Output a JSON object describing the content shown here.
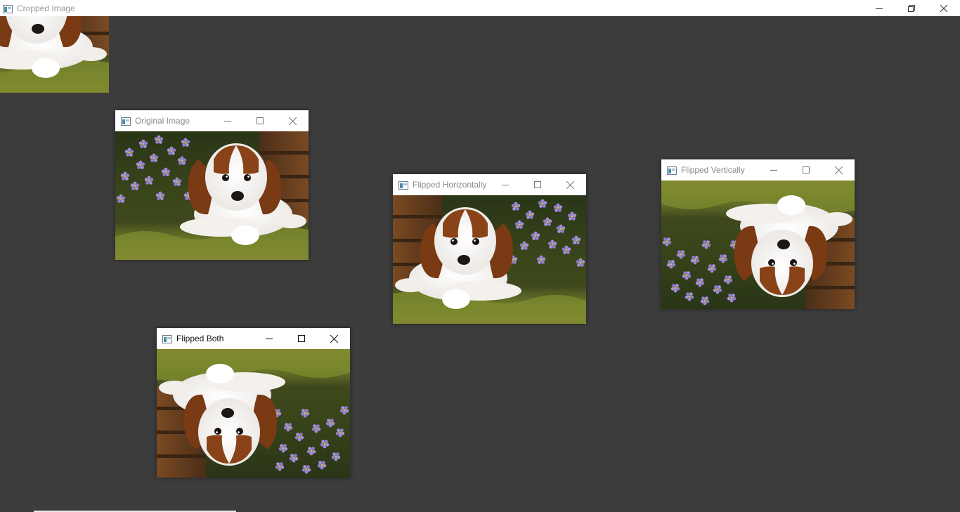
{
  "main_window": {
    "title": "Cropped Image",
    "controls": [
      "minimize",
      "restore",
      "close"
    ]
  },
  "windows": [
    {
      "id": "original",
      "title": "Original Image",
      "active": false
    },
    {
      "id": "flipped-horizontally",
      "title": "Flipped Horizontally",
      "active": false
    },
    {
      "id": "flipped-vertically",
      "title": "Flipped Vertically",
      "active": false
    },
    {
      "id": "flipped-both",
      "title": "Flipped Both",
      "active": true
    }
  ],
  "colors": {
    "desktop_bg": "#3c3c3c",
    "titlebar_bg": "#ffffff",
    "inactive_title": "#8a8a8a",
    "active_title": "#111111"
  },
  "icons": {
    "window_app_icon": "window-app-icon",
    "minimize": "minimize-icon",
    "maximize": "maximize-icon",
    "restore": "restore-icon",
    "close": "close-icon"
  }
}
